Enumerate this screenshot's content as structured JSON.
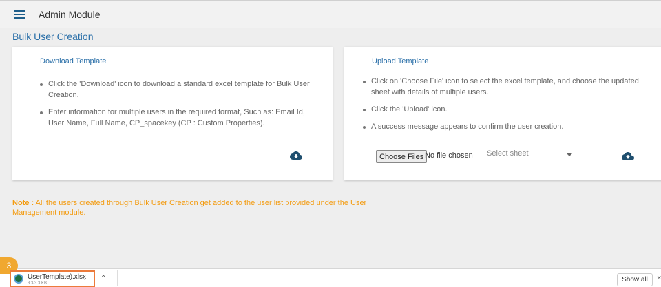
{
  "header": {
    "title": "Admin Module"
  },
  "page": {
    "title": "Bulk User Creation"
  },
  "download_card": {
    "title": "Download Template",
    "bullets": [
      "Click the 'Download' icon to download a standard excel template for Bulk User Creation.",
      "Enter information for multiple users in the required format, Such as: Email Id, User Name, Full Name, CP_spacekey (CP : Custom Properties)."
    ],
    "icon": "cloud-download-icon"
  },
  "upload_card": {
    "title": "Upload Template",
    "bullets": [
      "Click on 'Choose File' icon to select the excel template, and choose the updated sheet with details of multiple users.",
      "Click the 'Upload' icon.",
      "A success message appears to confirm the user creation."
    ],
    "choose_files_label": "Choose Files",
    "no_file_text": "No file chosen",
    "select_sheet_placeholder": "Select sheet",
    "icon": "cloud-upload-icon"
  },
  "note": {
    "label": "Note :",
    "text": " All the users created through Bulk User Creation get added to the user list provided under the User Management module."
  },
  "downloads_bar": {
    "step_number": "3",
    "file_name": "UserTemplate).xlsx",
    "file_size": "3.3/3.3 KB",
    "show_all_label": "Show all",
    "close_symbol": "×"
  },
  "colors": {
    "accent": "#2a6fa8",
    "note": "#f39c12",
    "highlight": "#ec7a3b",
    "badge": "#f0a830"
  }
}
